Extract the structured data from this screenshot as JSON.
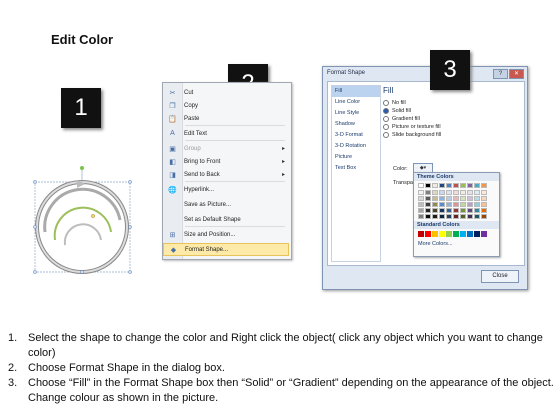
{
  "title": "Edit Color",
  "badges": [
    "1",
    "2",
    "3"
  ],
  "context_menu": {
    "items": [
      {
        "label": "Cut",
        "icon": "scissors-icon",
        "glyph": "✂",
        "disabled": false,
        "submenu": false
      },
      {
        "label": "Copy",
        "icon": "copy-icon",
        "glyph": "❐",
        "disabled": false,
        "submenu": false
      },
      {
        "label": "Paste",
        "icon": "paste-icon",
        "glyph": "📋",
        "disabled": false,
        "submenu": false
      },
      {
        "label": "Edit Text",
        "icon": "edit-text-icon",
        "glyph": "A",
        "disabled": false,
        "submenu": false
      },
      {
        "label": "Group",
        "icon": "group-icon",
        "glyph": "▣",
        "disabled": true,
        "submenu": true
      },
      {
        "label": "Bring to Front",
        "icon": "bring-front-icon",
        "glyph": "◧",
        "disabled": false,
        "submenu": true
      },
      {
        "label": "Send to Back",
        "icon": "send-back-icon",
        "glyph": "◨",
        "disabled": false,
        "submenu": true
      },
      {
        "label": "Hyperlink...",
        "icon": "hyperlink-icon",
        "glyph": "🌐",
        "disabled": false,
        "submenu": false
      },
      {
        "label": "Save as Picture...",
        "icon": "",
        "glyph": "",
        "disabled": false,
        "submenu": false
      },
      {
        "label": "Set as Default Shape",
        "icon": "",
        "glyph": "",
        "disabled": false,
        "submenu": false
      },
      {
        "label": "Size and Position...",
        "icon": "size-position-icon",
        "glyph": "⊞",
        "disabled": false,
        "submenu": false
      },
      {
        "label": "Format Shape...",
        "icon": "format-shape-icon",
        "glyph": "◆",
        "disabled": false,
        "submenu": false,
        "highlighted": true
      }
    ]
  },
  "dialog": {
    "title": "Format Shape",
    "nav": [
      "Fill",
      "Line Color",
      "Line Style",
      "Shadow",
      "3-D Format",
      "3-D Rotation",
      "Picture",
      "Text Box"
    ],
    "selected_nav": "Fill",
    "section_heading": "Fill",
    "options": [
      "No fill",
      "Solid fill",
      "Gradient fill",
      "Picture or texture fill",
      "Slide background fill"
    ],
    "selected_option": "Solid fill",
    "color_label": "Color:",
    "transparency_label": "Transpa",
    "palette": {
      "theme_heading": "Theme Colors",
      "theme_top": [
        "#ffffff",
        "#000000",
        "#eeece1",
        "#1f497d",
        "#4f81bd",
        "#c0504d",
        "#9bbb59",
        "#8064a2",
        "#4bacc6",
        "#f79646"
      ],
      "theme_rows": [
        [
          "#f2f2f2",
          "#7f7f7f",
          "#ddd9c3",
          "#c6d9f0",
          "#dbe5f1",
          "#f2dcdb",
          "#ebf1dd",
          "#e5e0ec",
          "#dbeef3",
          "#fdeada"
        ],
        [
          "#d8d8d8",
          "#595959",
          "#c4bd97",
          "#8db3e2",
          "#b8cce4",
          "#e5b9b7",
          "#d7e3bc",
          "#ccc1d9",
          "#b7dde8",
          "#fbd5b5"
        ],
        [
          "#bfbfbf",
          "#3f3f3f",
          "#938953",
          "#548dd4",
          "#95b3d7",
          "#d99694",
          "#c3d69b",
          "#b2a2c7",
          "#92cddc",
          "#fac08f"
        ],
        [
          "#a5a5a5",
          "#262626",
          "#494429",
          "#17365d",
          "#366092",
          "#953734",
          "#76923c",
          "#5f497a",
          "#31859b",
          "#e36c09"
        ],
        [
          "#7f7f7f",
          "#0c0c0c",
          "#1d1b10",
          "#0f243e",
          "#244061",
          "#632423",
          "#4f6128",
          "#3f3151",
          "#205867",
          "#974806"
        ]
      ],
      "standard_heading": "Standard Colors",
      "standard": [
        "#c00000",
        "#ff0000",
        "#ffc000",
        "#ffff00",
        "#92d050",
        "#00b050",
        "#00b0f0",
        "#0070c0",
        "#002060",
        "#7030a0"
      ],
      "more_label": "More Colors..."
    },
    "close_label": "Close"
  },
  "steps": [
    {
      "num": "1.",
      "text": "Select the shape to change the color and Right click the object( click any object which you want to change color)"
    },
    {
      "num": "2.",
      "text": "Choose Format Shape in the dialog box."
    },
    {
      "num": "3.",
      "text": "Choose “Fill” in the Format Shape box then “Solid” or “Gradient” depending on the appearance of the object. Change colour as shown in the picture."
    }
  ]
}
